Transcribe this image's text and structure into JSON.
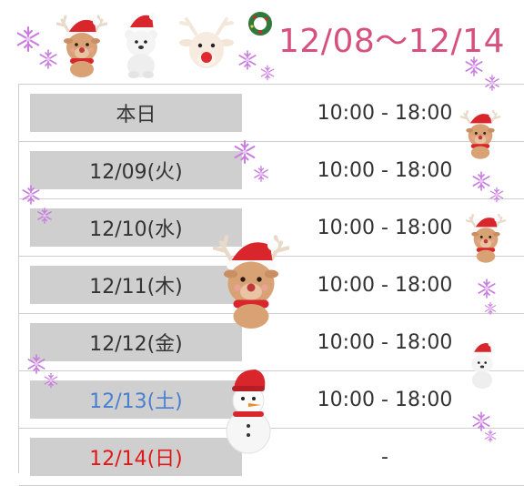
{
  "header": {
    "date_range": "12/08～12/14"
  },
  "schedule": {
    "rows": [
      {
        "day": "本日",
        "hours": "10:00 - 18:00",
        "type": "today"
      },
      {
        "day": "12/09(火)",
        "hours": "10:00 - 18:00",
        "type": "weekday"
      },
      {
        "day": "12/10(水)",
        "hours": "10:00 - 18:00",
        "type": "weekday"
      },
      {
        "day": "12/11(木)",
        "hours": "10:00 - 18:00",
        "type": "weekday"
      },
      {
        "day": "12/12(金)",
        "hours": "10:00 - 18:00",
        "type": "weekday"
      },
      {
        "day": "12/13(土)",
        "hours": "10:00 - 18:00",
        "type": "saturday"
      },
      {
        "day": "12/14(日)",
        "hours": "-",
        "type": "sunday"
      }
    ]
  },
  "colors": {
    "range_text": "#d6517d",
    "saturday": "#4a7fd0",
    "sunday": "#e01818",
    "day_cell_bg": "#cfcfcf",
    "snowflake": "#c97be0"
  },
  "decorations": [
    "reindeer-santa-hat-icon",
    "polar-bear-santa-hat-icon",
    "reindeer-icon",
    "wreath-icon",
    "snowman-icon",
    "snowflake-icon"
  ]
}
